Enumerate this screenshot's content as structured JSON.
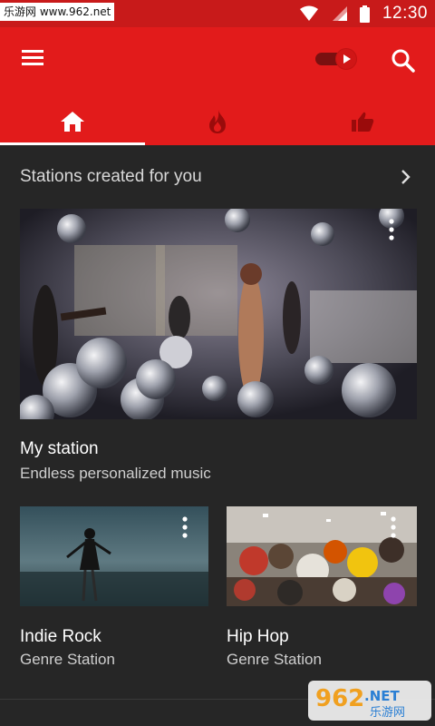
{
  "watermark": {
    "site_text": "乐游网 www.962.net"
  },
  "status_bar": {
    "time": "12:30"
  },
  "app_bar": {
    "icons": {
      "menu": "menu-icon",
      "toggle": "music-video-toggle-icon",
      "search": "search-icon"
    },
    "tabs": [
      {
        "icon": "home-icon",
        "active": true
      },
      {
        "icon": "trending-icon",
        "active": false
      },
      {
        "icon": "thumb-up-icon",
        "active": false
      }
    ]
  },
  "section": {
    "title": "Stations created for you",
    "chevron": "chevron-right-icon"
  },
  "cards": [
    {
      "title": "My station",
      "subtitle": "Endless personalized music"
    },
    {
      "title": "Indie Rock",
      "subtitle": "Genre Station"
    },
    {
      "title": "Hip Hop",
      "subtitle": "Genre Station"
    }
  ],
  "logo": {
    "number": "962",
    "suffix": ".NET",
    "cn": "乐游网"
  },
  "colors": {
    "app_bar": "#e21b1b",
    "status_bar": "#c81a1a",
    "background": "#262626"
  }
}
